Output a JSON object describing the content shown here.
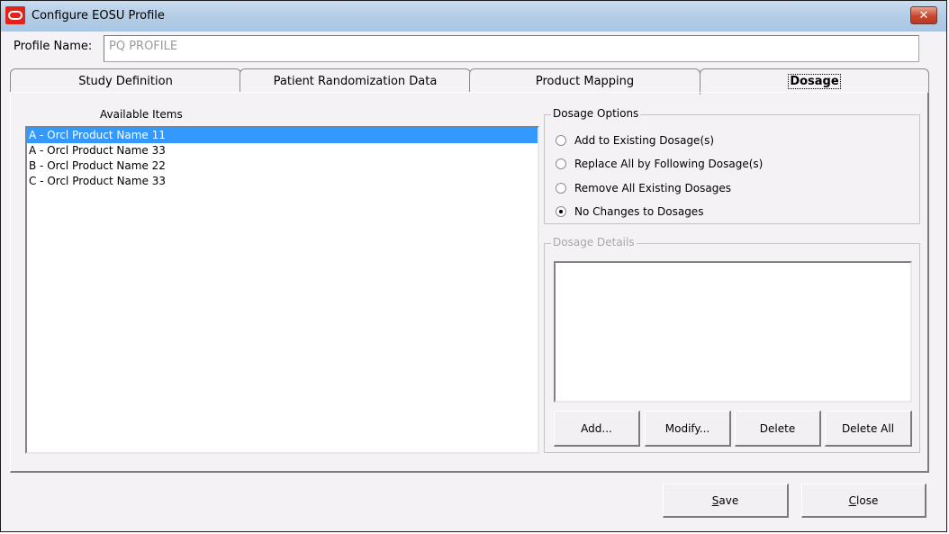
{
  "window": {
    "title": "Configure EOSU Profile",
    "close_label": "✕"
  },
  "profile": {
    "label": "Profile Name:",
    "value": "PQ PROFILE"
  },
  "tabs": [
    {
      "label": "Study Definition",
      "active": false
    },
    {
      "label": "Patient Randomization Data",
      "active": false
    },
    {
      "label": "Product Mapping",
      "active": false
    },
    {
      "label": "Dosage",
      "active": true
    }
  ],
  "available_items": {
    "label": "Available Items",
    "items": [
      {
        "label": "A - Orcl Product Name 11",
        "selected": true
      },
      {
        "label": "A - Orcl Product Name 33",
        "selected": false
      },
      {
        "label": "B - Orcl Product Name 22",
        "selected": false
      },
      {
        "label": "C - Orcl Product Name 33",
        "selected": false
      }
    ]
  },
  "dosage_options": {
    "legend": "Dosage Options",
    "options": [
      {
        "label": "Add to Existing Dosage(s)",
        "checked": false
      },
      {
        "label": "Replace All by Following Dosage(s)",
        "checked": false
      },
      {
        "label": "Remove All Existing Dosages",
        "checked": false
      },
      {
        "label": "No Changes to Dosages",
        "checked": true
      }
    ]
  },
  "dosage_details": {
    "legend": "Dosage Details",
    "buttons": {
      "add": "Add...",
      "modify": "Modify...",
      "delete": "Delete",
      "delete_all": "Delete All"
    }
  },
  "footer": {
    "save_mnemonic": "S",
    "save_rest": "ave",
    "close_mnemonic": "C",
    "close_rest": "lose"
  },
  "colors": {
    "selection": "#3399ff",
    "close_button": "#c9472f",
    "oracle_logo": "#e2231a"
  }
}
